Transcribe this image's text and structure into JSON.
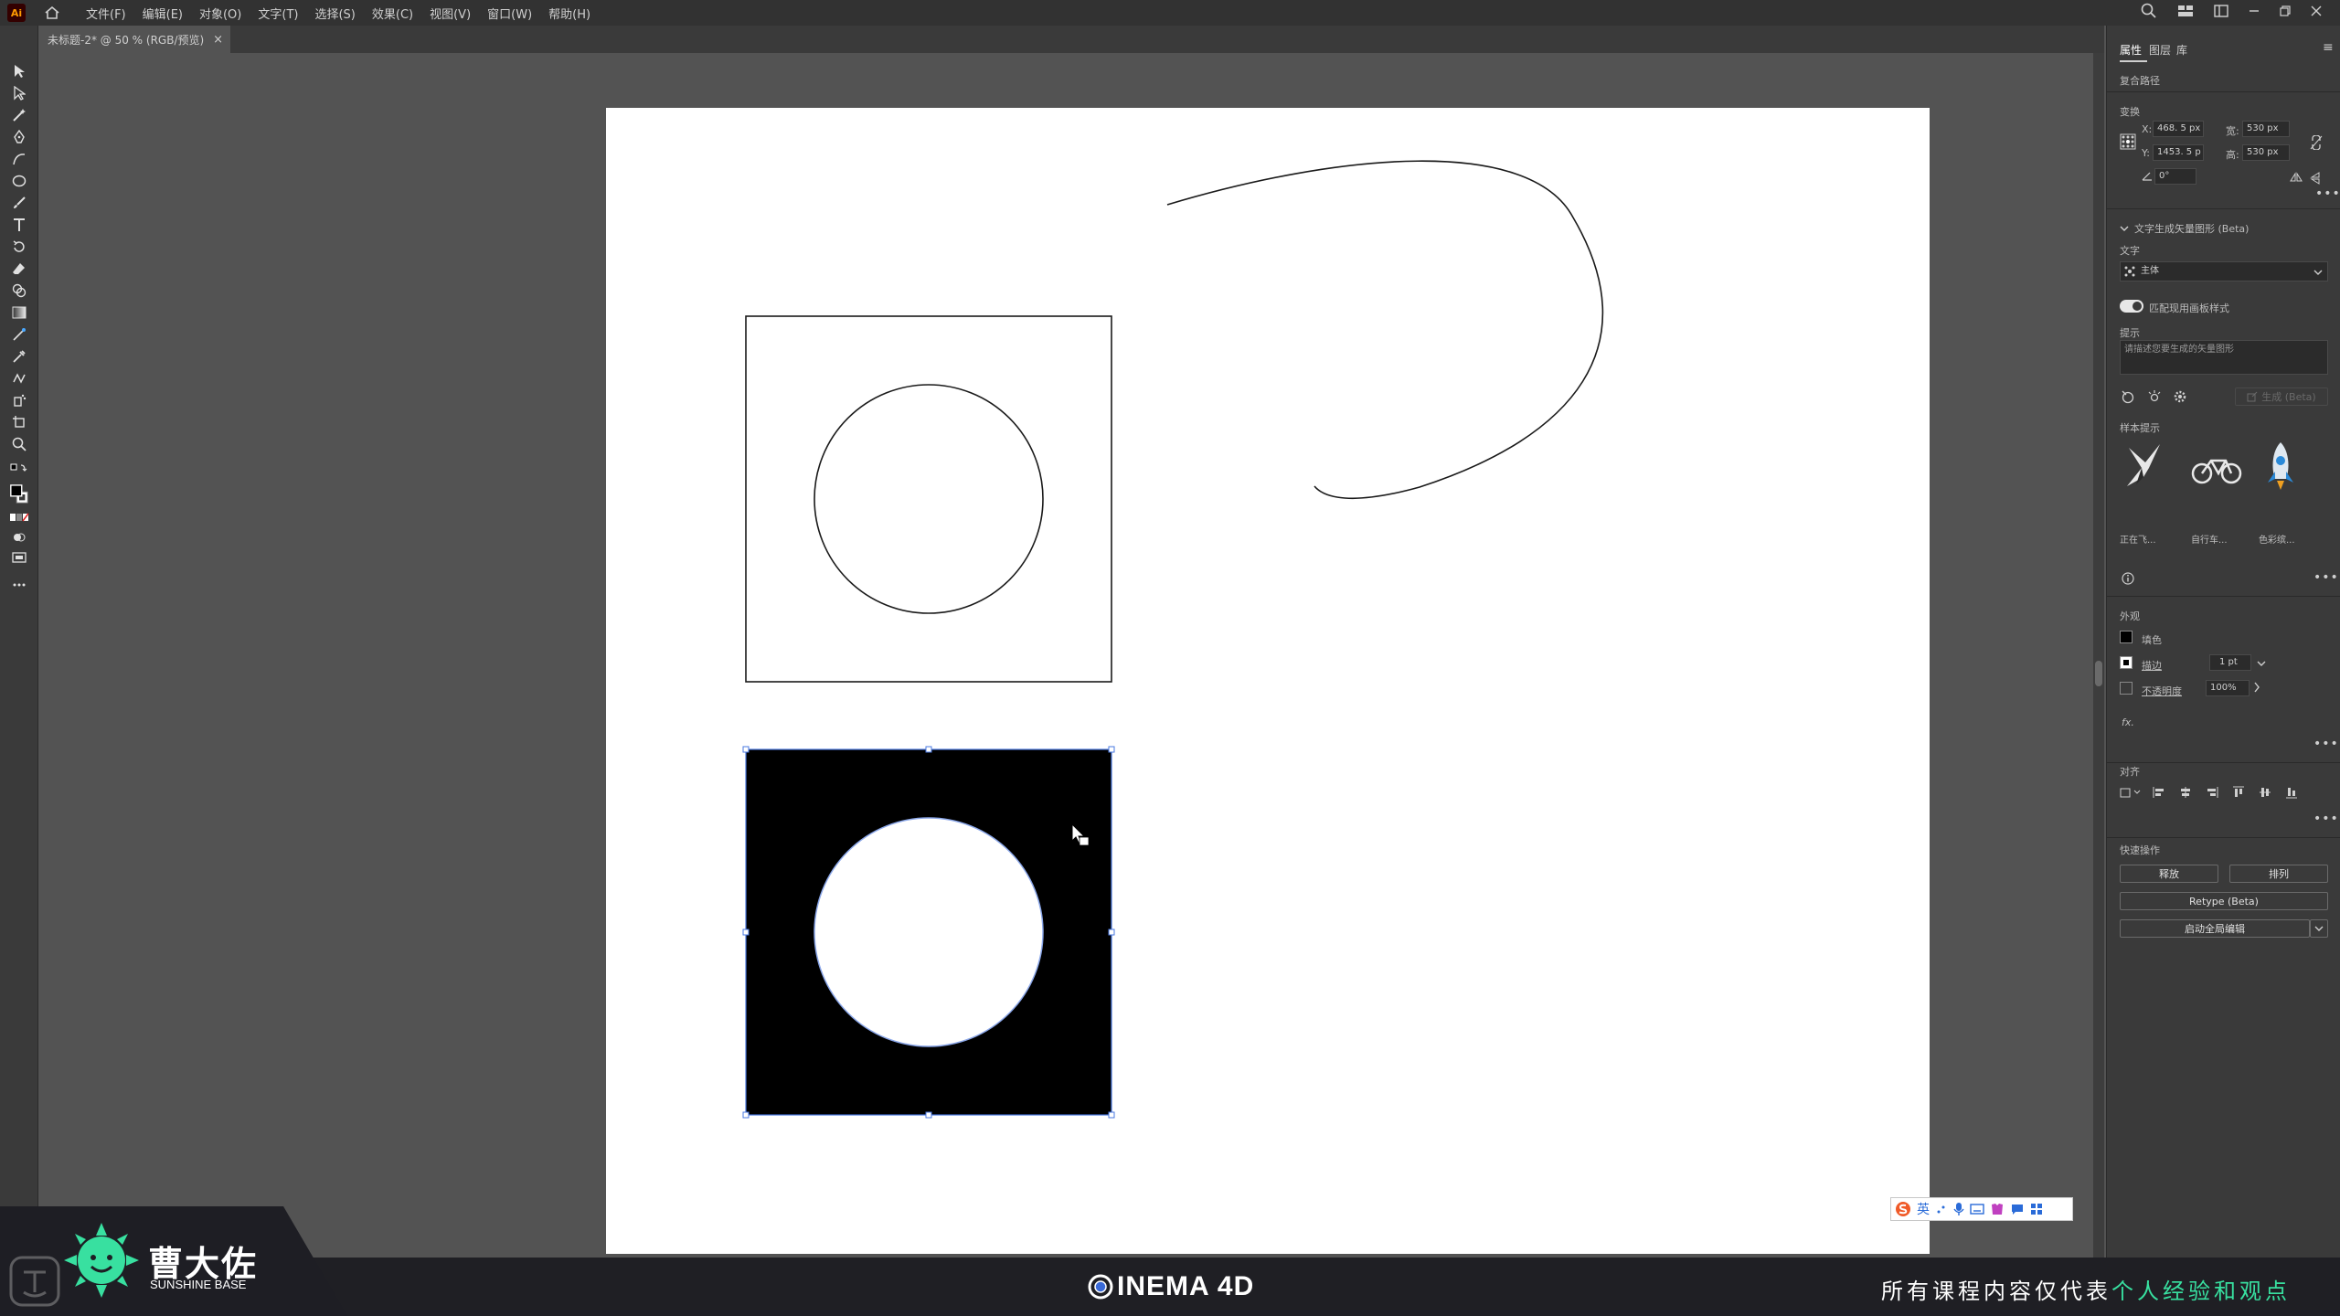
{
  "menubar": {
    "logo": "Ai",
    "items": [
      "文件(F)",
      "编辑(E)",
      "对象(O)",
      "文字(T)",
      "选择(S)",
      "效果(C)",
      "视图(V)",
      "窗口(W)",
      "帮助(H)"
    ]
  },
  "document": {
    "tab_title": "未标题-2* @ 50 % (RGB/预览)",
    "close_glyph": "×"
  },
  "panel": {
    "tabs": [
      "属性",
      "图层",
      "库"
    ],
    "object_type": "复合路径",
    "transform": {
      "title": "变换",
      "x_label": "X:",
      "x_value": "468. 5 px",
      "y_label": "Y:",
      "y_value": "1453. 5 p",
      "w_label": "宽:",
      "w_value": "530 px",
      "h_label": "高:",
      "h_value": "530 px",
      "angle_value": "0°"
    },
    "text_to_vector": {
      "title": "文字生成矢量图形 (Beta)",
      "type_label": "文字",
      "type_value": "主体",
      "toggle_label": "匹配现用画板样式",
      "prompt_label": "提示",
      "prompt_placeholder": "请描述您要生成的矢量图形",
      "generate_label": "生成 (Beta)",
      "samples_title": "样本提示",
      "samples": [
        "正在飞...",
        "自行车...",
        "色彩缤..."
      ]
    },
    "appearance": {
      "title": "外观",
      "fill_label": "填色",
      "stroke_label": "描边",
      "stroke_value": "1 pt",
      "opacity_label": "不透明度",
      "opacity_value": "100%",
      "fx_label": "fx."
    },
    "align": {
      "title": "对齐"
    },
    "quick_actions": {
      "title": "快速操作",
      "release": "释放",
      "arrange": "排列",
      "retype": "Retype (Beta)",
      "global_edit": "启动全局编辑"
    }
  },
  "overlay": {
    "brand_name": "曹大佐",
    "brand_sub": "SUNSHINE BASE",
    "c4d_title": "INEMA 4D",
    "disclaimer_plain": "所有课程内容仅代表",
    "disclaimer_highlight": "个人经验和观点",
    "ime_label": "英"
  },
  "colors": {
    "accent_green": "#38e0a0",
    "app_dark": "#3a3a3a",
    "canvas_bg": "#535353",
    "selection_blue": "#4a78e0"
  }
}
